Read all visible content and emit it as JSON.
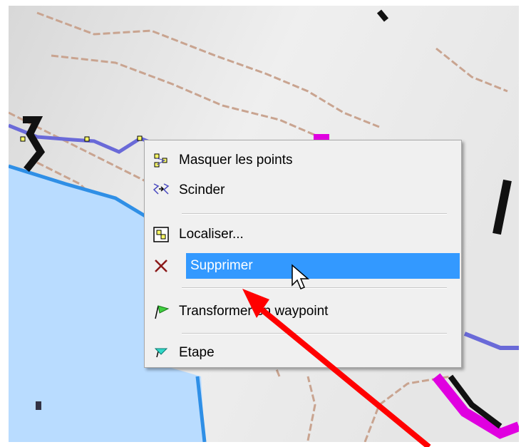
{
  "menu": {
    "items": [
      {
        "label": "Masquer les points",
        "icon": "show-points-icon"
      },
      {
        "label": "Scinder",
        "icon": "split-icon"
      },
      {
        "label": "Localiser...",
        "icon": "locate-icon"
      },
      {
        "label": "Supprimer",
        "icon": "delete-x-icon",
        "highlighted": true
      },
      {
        "label": "Transformer en waypoint",
        "icon": "green-flag-icon"
      },
      {
        "label": "Etape",
        "icon": "cyan-flag-icon"
      }
    ]
  },
  "colors": {
    "highlight": "#3399ff",
    "menu_bg": "#f0f0f0",
    "arrow": "#ff0000",
    "route": "#6a6ad8",
    "water": "#b9dcff",
    "magenta": "#e000e0"
  }
}
